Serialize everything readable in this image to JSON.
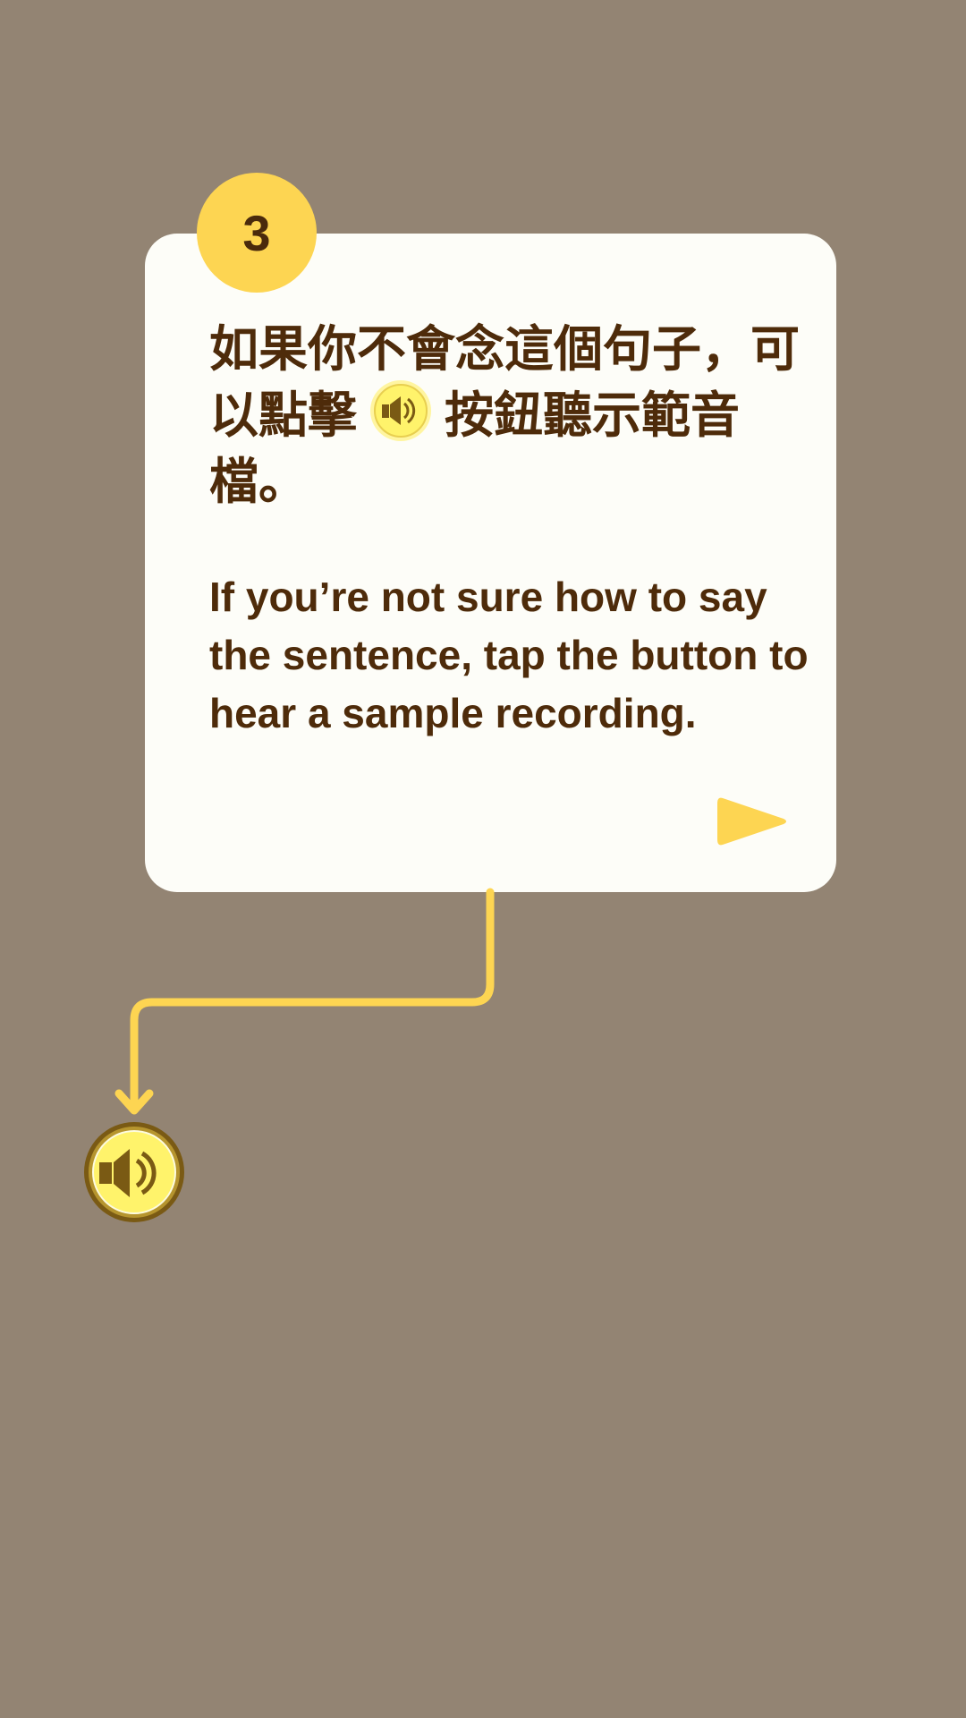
{
  "step": {
    "number": "3"
  },
  "instruction": {
    "zh_before": "如果你不會念這個句子，可以點擊",
    "zh_after": "按鈕聽示範音檔。",
    "en": "If you’re not sure how to say the sentence, tap the button to hear a sample recording."
  },
  "icons": {
    "inline": "speaker-icon",
    "next": "play-arrow-icon",
    "target": "speaker-icon"
  },
  "colors": {
    "background": "#938473",
    "card": "#fdfdf8",
    "accent": "#fdd552",
    "text": "#4e2b0a",
    "speaker_fill": "#fff36b",
    "speaker_ring": "#7a5a14"
  }
}
